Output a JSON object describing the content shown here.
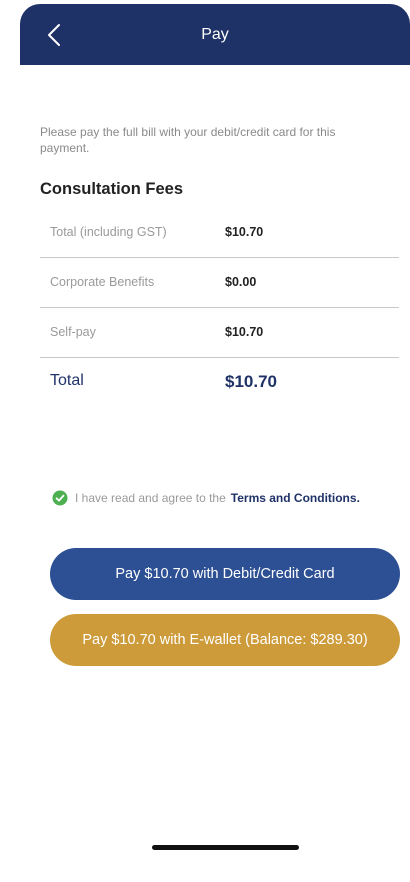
{
  "header": {
    "title": "Pay",
    "back_icon": "chevron-left-icon",
    "background_color": "#1f3268"
  },
  "intro_text": "Please pay the full bill with your debit/credit card for this payment.",
  "section_title": "Consultation Fees",
  "fees": [
    {
      "label": "Total (including GST)",
      "value": "$10.70"
    },
    {
      "label": "Corporate Benefits",
      "value": "$0.00"
    },
    {
      "label": "Self-pay",
      "value": "$10.70"
    }
  ],
  "total": {
    "label": "Total",
    "value": "$10.70"
  },
  "terms": {
    "checked": true,
    "check_icon": "check-circle-icon",
    "check_color": "#4caf50",
    "text": "I have read and agree to the",
    "link": "Terms and Conditions."
  },
  "buttons": {
    "card": {
      "label": "Pay $10.70 with Debit/Credit Card",
      "color": "#2d4f93"
    },
    "wallet": {
      "label": "Pay $10.70 with E-wallet (Balance: $289.30)",
      "color": "#cd9b3a"
    }
  }
}
